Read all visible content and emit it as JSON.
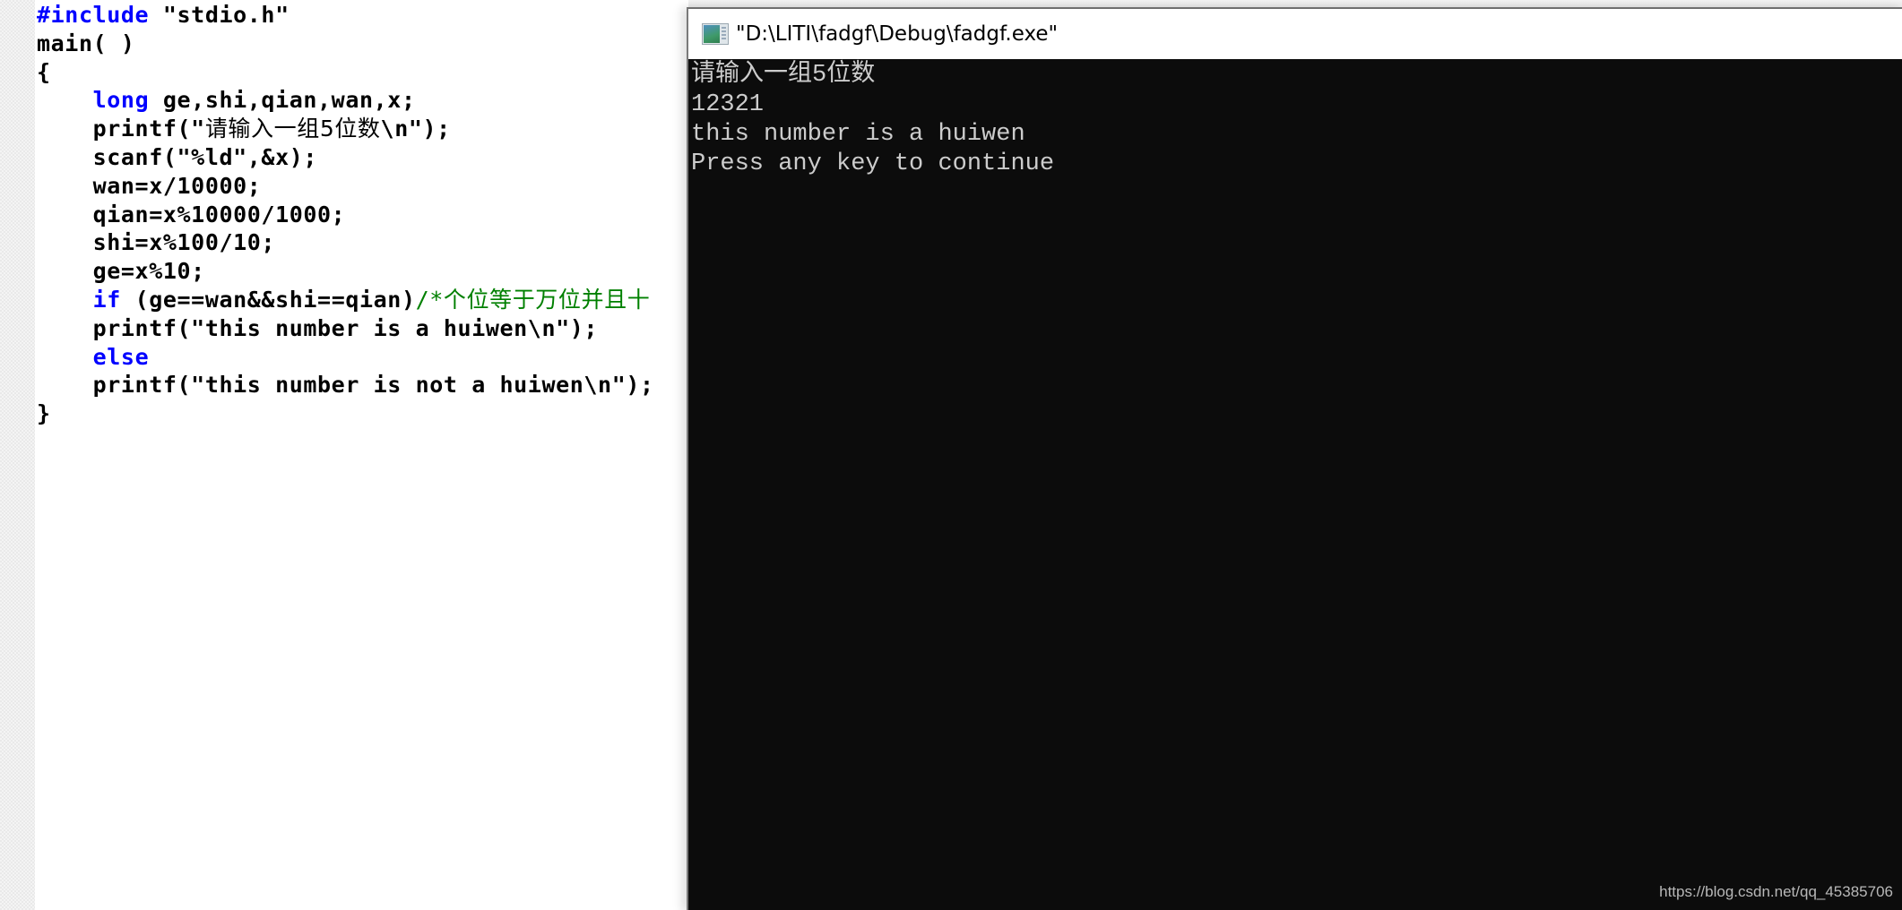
{
  "editor": {
    "lines": [
      [
        {
          "t": "#include",
          "c": "kw"
        },
        {
          "t": " \"stdio.h\"",
          "c": ""
        }
      ],
      [
        {
          "t": "main( )",
          "c": ""
        }
      ],
      [
        {
          "t": "{",
          "c": ""
        }
      ],
      [
        {
          "t": "    ",
          "c": ""
        },
        {
          "t": "long",
          "c": "kw"
        },
        {
          "t": " ge,shi,qian,wan,x;",
          "c": ""
        }
      ],
      [
        {
          "t": "    printf(\"",
          "c": ""
        },
        {
          "t": "请输入一组5位数",
          "c": "cjk"
        },
        {
          "t": "\\n\");",
          "c": ""
        }
      ],
      [
        {
          "t": "    scanf(\"%ld\",&x);",
          "c": ""
        }
      ],
      [
        {
          "t": "    wan=x/10000;",
          "c": ""
        }
      ],
      [
        {
          "t": "    qian=x%10000/1000;",
          "c": ""
        }
      ],
      [
        {
          "t": "    shi=x%100/10;",
          "c": ""
        }
      ],
      [
        {
          "t": "    ge=x%10;",
          "c": ""
        }
      ],
      [
        {
          "t": "    ",
          "c": ""
        },
        {
          "t": "if",
          "c": "kw"
        },
        {
          "t": " (ge==wan&&shi==qian)",
          "c": ""
        },
        {
          "t": "/*个位等于万位并且十",
          "c": "cm"
        }
      ],
      [
        {
          "t": "    printf(\"this number is a huiwen\\n\");",
          "c": ""
        }
      ],
      [
        {
          "t": "    ",
          "c": ""
        },
        {
          "t": "else",
          "c": "kw"
        }
      ],
      [
        {
          "t": "    printf(\"this number is not a huiwen\\n\");",
          "c": ""
        }
      ],
      [
        {
          "t": "}",
          "c": ""
        }
      ]
    ],
    "colors": {
      "keyword": "#0000ff",
      "comment": "#008000",
      "text": "#000000"
    }
  },
  "console": {
    "window_title": "\"D:\\LITI\\fadgf\\Debug\\fadgf.exe\"",
    "icon": "console-app-icon",
    "output_lines": [
      "请输入一组5位数",
      "12321",
      "this number is a huiwen",
      "Press any key to continue"
    ],
    "colors": {
      "background": "#0c0c0c",
      "text": "#cccccc"
    }
  },
  "watermark": "https://blog.csdn.net/qq_45385706"
}
